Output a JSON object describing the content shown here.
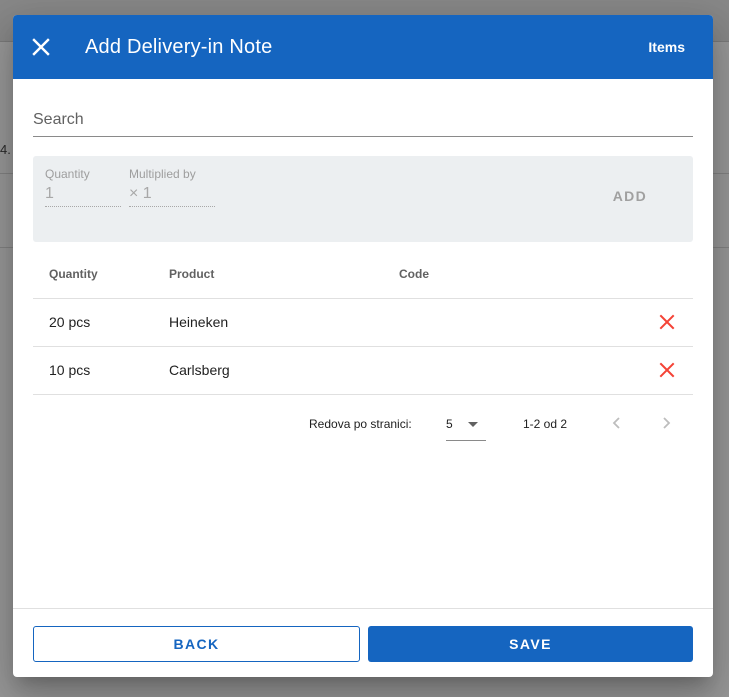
{
  "background": {
    "row_fragment": "4."
  },
  "dialog": {
    "title": "Add Delivery-in Note",
    "items_label": "Items",
    "search": {
      "placeholder": "Search",
      "value": ""
    },
    "add_form": {
      "quantity_label": "Quantity",
      "quantity_value": "1",
      "multiplied_label": "Multiplied by",
      "multiplied_value": "× 1",
      "add_label": "ADD"
    },
    "table": {
      "headers": [
        "Quantity",
        "Product",
        "Code"
      ],
      "rows": [
        {
          "quantity": "20 pcs",
          "product": "Heineken",
          "code": ""
        },
        {
          "quantity": "10 pcs",
          "product": "Carlsberg",
          "code": ""
        }
      ]
    },
    "pagination": {
      "rows_per_page_label": "Redova po stranici:",
      "rows_per_page_value": "5",
      "range_text": "1-2 od 2"
    },
    "footer": {
      "back_label": "BACK",
      "save_label": "SAVE"
    }
  },
  "colors": {
    "primary": "#1565c0",
    "delete": "#f44336"
  },
  "icons": [
    "close-icon",
    "delete-icon",
    "chevron-left-icon",
    "chevron-right-icon",
    "dropdown-caret-icon"
  ]
}
